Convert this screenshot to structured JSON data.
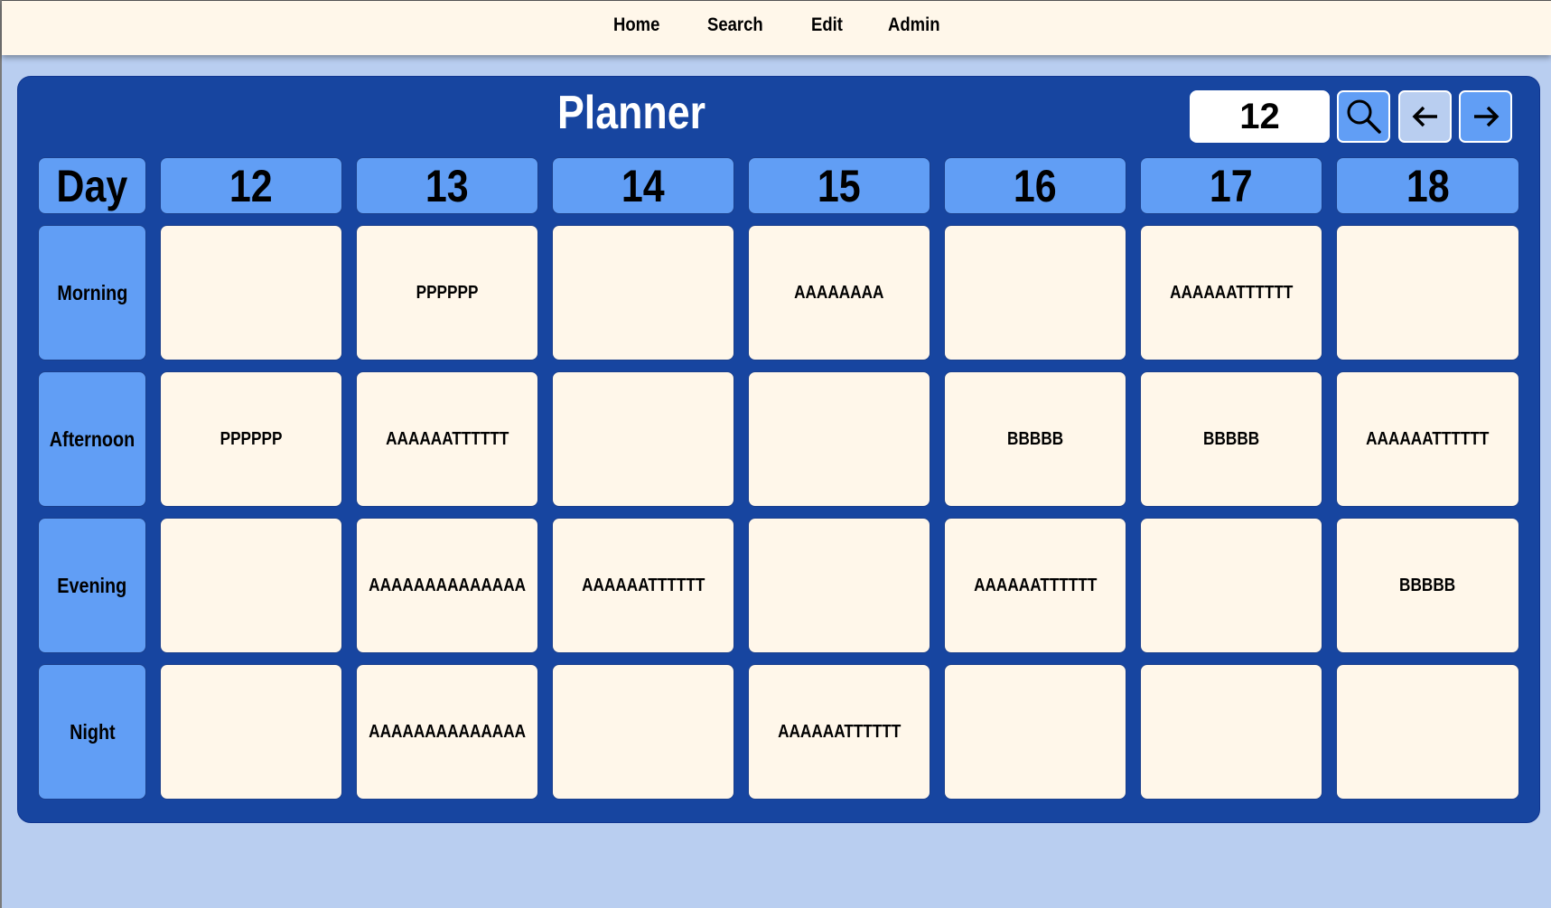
{
  "nav": {
    "items": [
      {
        "label": "Home"
      },
      {
        "label": "Search"
      },
      {
        "label": "Edit"
      },
      {
        "label": "Admin"
      }
    ]
  },
  "planner": {
    "title": "Planner",
    "day_input_value": "12",
    "controls": {
      "search_icon": "search-icon",
      "prev_icon": "arrow-left-icon",
      "next_icon": "arrow-right-icon"
    },
    "corner_label": "Day",
    "days": [
      "12",
      "13",
      "14",
      "15",
      "16",
      "17",
      "18"
    ],
    "rows": [
      {
        "label": "Morning",
        "slots": [
          "",
          "PPPPPP",
          "",
          "AAAAAAAA",
          "",
          "AAAAAATTTTTT",
          ""
        ]
      },
      {
        "label": "Afternoon",
        "slots": [
          "PPPPPP",
          "AAAAAATTTTTT",
          "",
          "",
          "BBBBB",
          "BBBBB",
          "AAAAAATTTTTT"
        ]
      },
      {
        "label": "Evening",
        "slots": [
          "",
          "AAAAAAAAAAAAAA",
          "AAAAAATTTTTT",
          "",
          "AAAAAATTTTTT",
          "",
          "BBBBB"
        ]
      },
      {
        "label": "Night",
        "slots": [
          "",
          "AAAAAAAAAAAAAA",
          "",
          "AAAAAATTTTTT",
          "",
          "",
          ""
        ]
      }
    ]
  },
  "colors": {
    "page_bg": "#b9cef0",
    "nav_bg": "#fff7ea",
    "panel_bg": "#1745a0",
    "header_bg": "#619ef5",
    "slot_bg": "#fff7ea",
    "prev_button_bg": "#b9cef0"
  }
}
